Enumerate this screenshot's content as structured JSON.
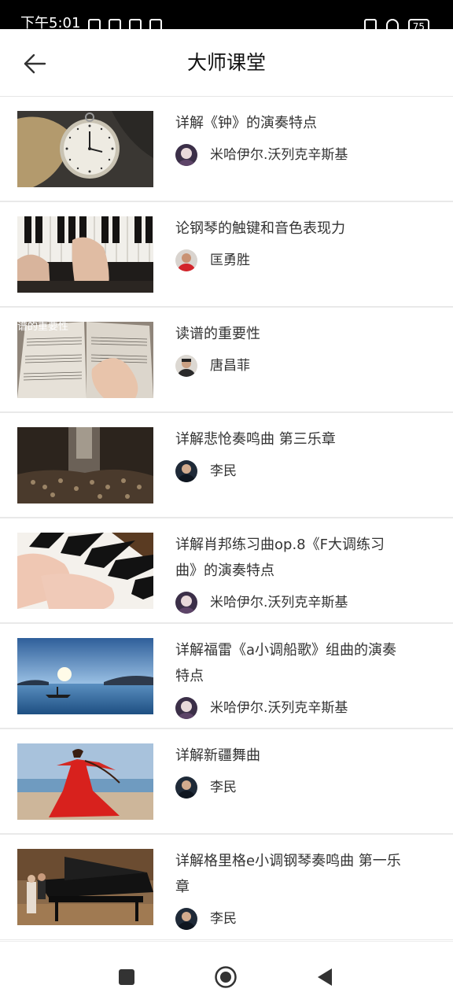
{
  "status_bar": {
    "time": "下午5:01",
    "battery": "75"
  },
  "header": {
    "title": "大师课堂",
    "back_icon": "arrow-left-icon"
  },
  "courses": [
    {
      "title": "详解《钟》的演奏特点",
      "teacher": "米哈伊尔.沃列克辛斯基",
      "thumbnail_overlay": ""
    },
    {
      "title": "论钢琴的触键和音色表现力",
      "teacher": "匡勇胜",
      "thumbnail_overlay": ""
    },
    {
      "title": "读谱的重要性",
      "teacher": "唐昌菲",
      "thumbnail_overlay": "谱的重要性"
    },
    {
      "title": "详解悲怆奏鸣曲 第三乐章",
      "teacher": "李民",
      "thumbnail_overlay": ""
    },
    {
      "title": "详解肖邦练习曲op.8《F大调练习曲》的演奏特点",
      "teacher": "米哈伊尔.沃列克辛斯基",
      "thumbnail_overlay": ""
    },
    {
      "title": "详解福雷《a小调船歌》组曲的演奏特点",
      "teacher": "米哈伊尔.沃列克辛斯基",
      "thumbnail_overlay": ""
    },
    {
      "title": "详解新疆舞曲",
      "teacher": "李民",
      "thumbnail_overlay": ""
    },
    {
      "title": "详解格里格e小调钢琴奏鸣曲 第一乐章",
      "teacher": "李民",
      "thumbnail_overlay": ""
    }
  ],
  "nav_bar": {
    "icons": [
      "square-recents-icon",
      "circle-home-icon",
      "triangle-back-icon"
    ]
  }
}
